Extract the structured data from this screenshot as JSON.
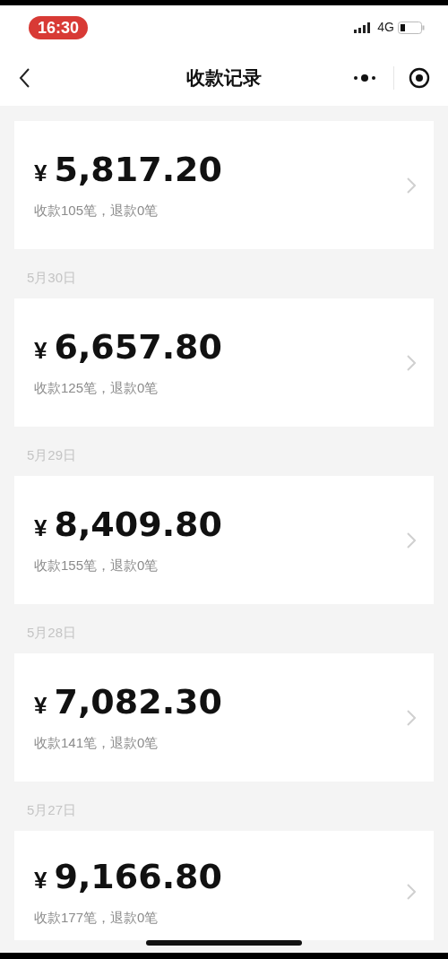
{
  "status_bar": {
    "time": "16:30",
    "network": "4G"
  },
  "nav_bar": {
    "title": "收款记录"
  },
  "records": [
    {
      "currency": "¥",
      "amount": "5,817.20",
      "summary": "收款105笔，退款0笔"
    },
    {
      "date": "5月30日",
      "currency": "¥",
      "amount": "6,657.80",
      "summary": "收款125笔，退款0笔"
    },
    {
      "date": "5月29日",
      "currency": "¥",
      "amount": "8,409.80",
      "summary": "收款155笔，退款0笔"
    },
    {
      "date": "5月28日",
      "currency": "¥",
      "amount": "7,082.30",
      "summary": "收款141笔，退款0笔"
    },
    {
      "date": "5月27日",
      "currency": "¥",
      "amount": "9,166.80",
      "summary": "收款177笔，退款0笔"
    }
  ]
}
